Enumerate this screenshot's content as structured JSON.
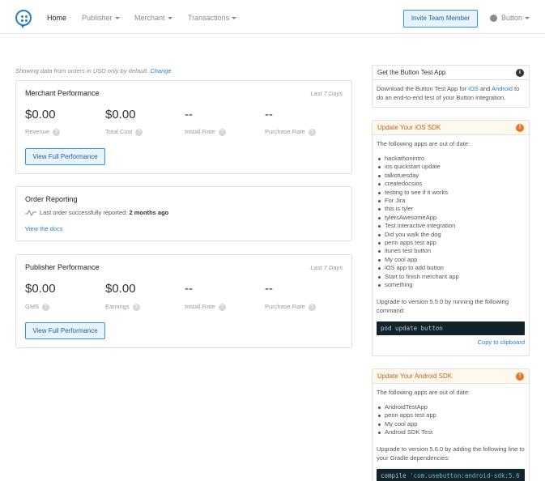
{
  "nav": {
    "home": "Home",
    "publisher": "Publisher",
    "merchant": "Merchant",
    "transactions": "Transactions",
    "invite": "Invite Team Member",
    "user": "Button"
  },
  "notice": {
    "text": "Showing data from orders in USD only by default.",
    "link": "Change"
  },
  "merchant_perf": {
    "title": "Merchant Performance",
    "period": "Last 7 Days",
    "metrics": [
      {
        "value": "$0.00",
        "label": "Revenue"
      },
      {
        "value": "$0.00",
        "label": "Total Cost"
      },
      {
        "value": "--",
        "label": "Install Rate"
      },
      {
        "value": "--",
        "label": "Purchase Rate"
      }
    ],
    "button": "View Full Performance"
  },
  "order_reporting": {
    "title": "Order Reporting",
    "status_prefix": "Last order successfully reported:",
    "status_value": "2 months ago",
    "link": "View the docs"
  },
  "publisher_perf": {
    "title": "Publisher Performance",
    "period": "Last 7 Days",
    "metrics": [
      {
        "value": "$0.00",
        "label": "GMS"
      },
      {
        "value": "$0.00",
        "label": "Earnings"
      },
      {
        "value": "--",
        "label": "Install Rate"
      },
      {
        "value": "--",
        "label": "Purchase Rate"
      }
    ],
    "button": "View Full Performance"
  },
  "test_app": {
    "title": "Get the Button Test App",
    "text_a": "Download the Button Test App for ",
    "ios": "iOS",
    "and": " and ",
    "android": "Android",
    "text_b": " to do an end-to-end test of your Button integration."
  },
  "ios_sdk": {
    "title": "Update Your iOS SDK",
    "intro": "The following apps are out of date:",
    "apps": [
      "hackathonintro",
      "ios quickstart update",
      "talkotuesday",
      "createdocsios",
      "testing to see if it works",
      "For Jira",
      "this is tyler",
      "tylersAwesomeApp",
      "Test interactive integration",
      "Did you walk the dog",
      "penn apps test app",
      "itunes test button",
      "My cool app",
      "iOS app to add button",
      "Start to finish merchant app",
      "something"
    ],
    "upgrade": "Upgrade to version 5.5.0 by running the following command:",
    "command": "pod update button",
    "copy": "Copy to clipboard"
  },
  "android_sdk": {
    "title": "Update Your Android SDK",
    "intro": "The following apps are out of date:",
    "apps": [
      "AndroidTestApp",
      "penn apps test app",
      "My cool app",
      "Android SDK Test"
    ],
    "upgrade": "Upgrade to version 5.6.0 by adding the following line to your Gradle dependencies:",
    "code_prefix": "compile ",
    "code_string": "'com.usebutton:android-sdk:5.6"
  },
  "colors": {
    "accent": "#2a7fc4",
    "warning": "#e5762a",
    "info": "#333333"
  }
}
